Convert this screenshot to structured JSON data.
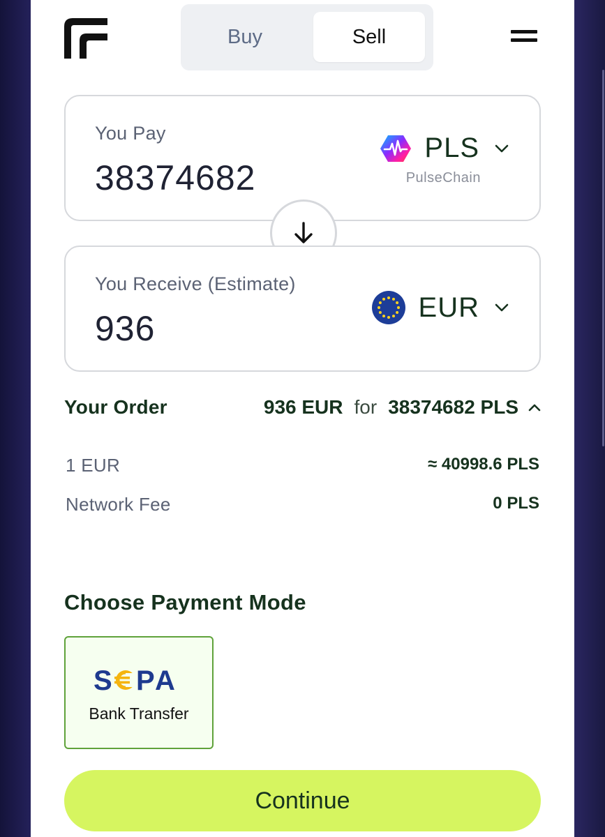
{
  "header": {
    "tabs": [
      {
        "label": "Buy",
        "active": false
      },
      {
        "label": "Sell",
        "active": true
      }
    ]
  },
  "pay": {
    "label": "You Pay",
    "amount": "38374682",
    "currency_code": "PLS",
    "currency_name": "PulseChain",
    "icon": "pulsechain-logo-icon"
  },
  "receive": {
    "label": "You Receive (Estimate)",
    "amount": "936",
    "currency_code": "EUR",
    "icon": "eu-flag-icon"
  },
  "order": {
    "title": "Your Order",
    "receive_summary": "936 EUR",
    "for_word": "for",
    "pay_summary": "38374682 PLS",
    "rate_label": "1 EUR",
    "rate_value": "≈ 40998.6 PLS",
    "fee_label": "Network Fee",
    "fee_value": "0 PLS"
  },
  "payment": {
    "title": "Choose Payment Mode",
    "options": [
      {
        "logo_text": "SEPA",
        "label": "Bank Transfer",
        "selected": true
      }
    ]
  },
  "actions": {
    "continue_label": "Continue"
  },
  "colors": {
    "accent": "#d6f560",
    "text_dark": "#16321e",
    "selected_border": "#5fa23a",
    "page_bg": "#1b1a44"
  }
}
